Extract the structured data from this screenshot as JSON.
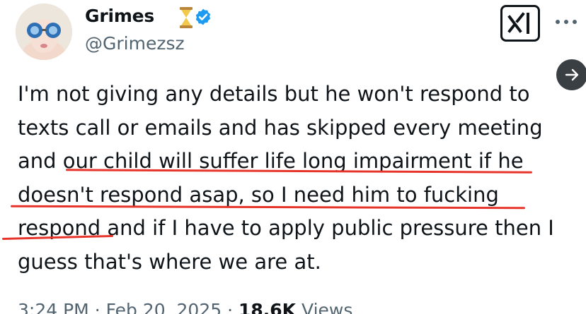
{
  "author": {
    "display_name": "Grimes",
    "handle": "@Grimezsz",
    "name_emoji": "hourglass-icon",
    "verified": true,
    "verified_color": "#1d9bf0"
  },
  "header": {
    "grok_button_icon": "grok-icon",
    "more_icon": "more-dots-icon",
    "next_icon": "arrow-right-icon"
  },
  "tweet": {
    "lines": [
      "I'm not giving any details but he won't respond to",
      "texts call or emails and has skipped every meeting",
      "and our child will suffer life long impairment if he",
      "doesn't respond asap, so I need him to fucking",
      "respond and if I have to apply public pressure then I",
      "guess that's where we are at."
    ],
    "highlight_color": "#e8352b"
  },
  "meta": {
    "time": "3:24 PM",
    "separator": "·",
    "date": "Feb 20, 2025",
    "views_count": "18.6K",
    "views_label": "Views"
  }
}
